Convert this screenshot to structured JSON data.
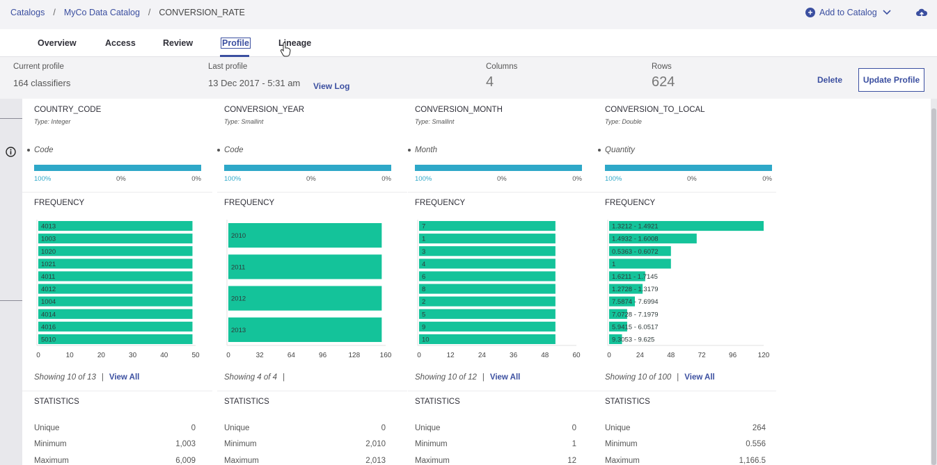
{
  "breadcrumb": {
    "items": [
      "Catalogs",
      "MyCo Data Catalog",
      "CONVERSION_RATE"
    ],
    "separator": "/"
  },
  "header": {
    "add_to_catalog_label": "Add to Catalog"
  },
  "tabs": [
    "Overview",
    "Access",
    "Review",
    "Profile",
    "Lineage"
  ],
  "active_tab": "Profile",
  "profile_info": {
    "current_profile_label": "Current profile",
    "current_profile_value": "164 classifiers",
    "last_profile_label": "Last profile",
    "last_profile_value": "13 Dec 2017 - 5:31 am",
    "view_log_label": "View Log",
    "columns_label": "Columns",
    "columns_value": "4",
    "rows_label": "Rows",
    "rows_value": "624",
    "delete_label": "Delete",
    "update_profile_label": "Update Profile"
  },
  "section_titles": {
    "frequency": "FREQUENCY",
    "statistics": "STATISTICS"
  },
  "stat_labels": [
    "Unique",
    "Minimum",
    "Maximum"
  ],
  "colors": {
    "accent": "#3b4fa0",
    "quality_bar": "#2ea8c8",
    "frequency_bar": "#14c39a"
  },
  "columns": [
    {
      "name": "COUNTRY_CODE",
      "type": "Type: Integer",
      "classification": "Code",
      "quality": [
        "100%",
        "0%",
        "0%"
      ],
      "showing": "Showing 10 of 13",
      "view_all": "View All",
      "stats": [
        "0",
        "1,003",
        "6,009"
      ]
    },
    {
      "name": "CONVERSION_YEAR",
      "type": "Type: Smallint",
      "classification": "Code",
      "quality": [
        "100%",
        "0%",
        "0%"
      ],
      "showing": "Showing 4 of 4",
      "view_all": "",
      "stats": [
        "0",
        "2,010",
        "2,013"
      ]
    },
    {
      "name": "CONVERSION_MONTH",
      "type": "Type: Smallint",
      "classification": "Month",
      "quality": [
        "100%",
        "0%",
        "0%"
      ],
      "showing": "Showing 10 of 12",
      "view_all": "View All",
      "stats": [
        "0",
        "1",
        "12"
      ]
    },
    {
      "name": "CONVERSION_TO_LOCAL",
      "type": "Type: Double",
      "classification": "Quantity",
      "quality": [
        "100%",
        "0%",
        "0%"
      ],
      "showing": "Showing 10 of 100",
      "view_all": "View All",
      "stats": [
        "264",
        "0.556",
        "1,166.5"
      ]
    }
  ],
  "chart_data": [
    {
      "type": "bar",
      "orientation": "horizontal",
      "categories": [
        "4013",
        "1003",
        "1020",
        "1021",
        "4011",
        "4012",
        "1004",
        "4014",
        "4016",
        "5010"
      ],
      "values": [
        49,
        49,
        49,
        49,
        49,
        49,
        49,
        49,
        49,
        49
      ],
      "xlim": [
        0,
        50
      ],
      "xticks": [
        "0",
        "10",
        "20",
        "30",
        "40",
        "50"
      ]
    },
    {
      "type": "bar",
      "orientation": "horizontal",
      "categories": [
        "2010",
        "2011",
        "2012",
        "2013"
      ],
      "values": [
        156,
        156,
        156,
        156
      ],
      "xlim": [
        0,
        160
      ],
      "xticks": [
        "0",
        "32",
        "64",
        "96",
        "128",
        "160"
      ]
    },
    {
      "type": "bar",
      "orientation": "horizontal",
      "categories": [
        "7",
        "1",
        "3",
        "4",
        "6",
        "8",
        "2",
        "5",
        "9",
        "10"
      ],
      "values": [
        52,
        52,
        52,
        52,
        52,
        52,
        52,
        52,
        52,
        52
      ],
      "xlim": [
        0,
        60
      ],
      "xticks": [
        "0",
        "12",
        "24",
        "36",
        "48",
        "60"
      ]
    },
    {
      "type": "bar",
      "orientation": "horizontal",
      "categories": [
        "1.3212 - 1.4921",
        "1.4932 - 1.6008",
        "0.5363 - 0.6072",
        "1",
        "1.6211 - 1.7145",
        "1.2728 - 1.3179",
        "7.5874 - 7.6994",
        "7.0728 - 7.1979",
        "5.9415 - 6.0517",
        "9.3053 - 9.625"
      ],
      "values": [
        120,
        68,
        48,
        48,
        28,
        26,
        20,
        14,
        14,
        10
      ],
      "xlim": [
        0,
        120
      ],
      "xticks": [
        "0",
        "24",
        "48",
        "72",
        "96",
        "120"
      ]
    }
  ]
}
